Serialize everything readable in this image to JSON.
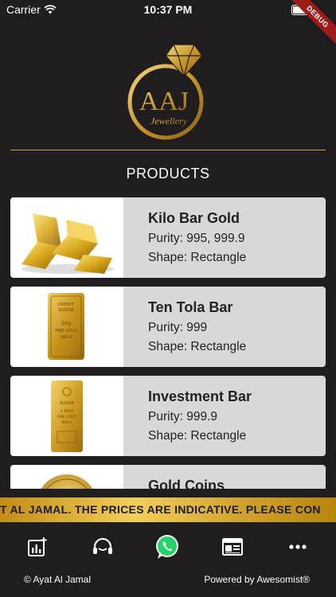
{
  "status": {
    "carrier": "Carrier",
    "time": "10:37 PM",
    "battery_level": 1.0
  },
  "debug_banner": "DEBUG",
  "logo": {
    "letters": "AAJ",
    "word": "Jewellery"
  },
  "section_title": "PRODUCTS",
  "products": [
    {
      "name": "Kilo Bar Gold",
      "purity": "Purity: 995, 999.9",
      "shape": "Shape: Rectangle"
    },
    {
      "name": "Ten Tola Bar",
      "purity": "Purity: 999",
      "shape": "Shape: Rectangle",
      "stamp": [
        "CREDIT",
        "SUISSE",
        "20g",
        "FINE GOLD",
        "999.9"
      ]
    },
    {
      "name": "Investment Bar",
      "purity": "Purity: 999.9",
      "shape": "Shape: Rectangle",
      "stamp": [
        "SUISSE",
        "1 KILO",
        "FINE GOLD",
        "999.9"
      ]
    },
    {
      "name": "Gold Coins"
    }
  ],
  "ticker": "T AL JAMAL.   THE PRICES ARE INDICATIVE.   PLEASE CON",
  "nav": [
    {
      "icon": "chart-icon"
    },
    {
      "icon": "headset-icon"
    },
    {
      "icon": "whatsapp-icon"
    },
    {
      "icon": "news-icon"
    },
    {
      "icon": "more-icon"
    }
  ],
  "footer": {
    "copyright": "© Ayat Al Jamal",
    "powered": "Powered by Awesomist®"
  },
  "colors": {
    "gold": "#c9a227",
    "background": "#1f1d1e",
    "card": "#d8d8d8",
    "whatsapp": "#25d366"
  }
}
